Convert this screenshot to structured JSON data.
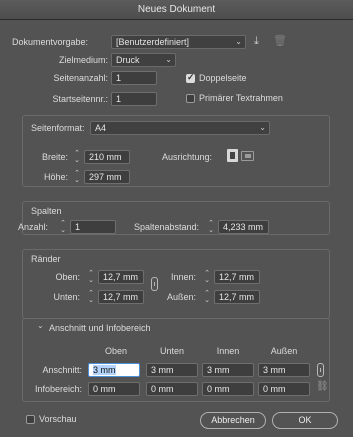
{
  "window": {
    "title": "Neues Dokument"
  },
  "top": {
    "preset_label": "Dokumentvorgabe:",
    "preset_value": "[Benutzerdefiniert]",
    "intent_label": "Zielmedium:",
    "intent_value": "Druck",
    "pages_label": "Seitenanzahl:",
    "pages_value": "1",
    "facing_label": "Doppelseite",
    "facing_checked": true,
    "start_label": "Startseitennr.:",
    "start_value": "1",
    "primary_frame_label": "Primärer Textrahmen",
    "primary_frame_checked": false
  },
  "page_size": {
    "label": "Seitenformat:",
    "value": "A4",
    "width_label": "Breite:",
    "width_value": "210 mm",
    "height_label": "Höhe:",
    "height_value": "297 mm",
    "orientation_label": "Ausrichtung:"
  },
  "columns": {
    "title": "Spalten",
    "number_label": "Anzahl:",
    "number_value": "1",
    "gutter_label": "Spaltenabstand:",
    "gutter_value": "4,233 mm"
  },
  "margins": {
    "title": "Ränder",
    "top_label": "Oben:",
    "top_value": "12,7 mm",
    "bottom_label": "Unten:",
    "bottom_value": "12,7 mm",
    "inside_label": "Innen:",
    "inside_value": "12,7 mm",
    "outside_label": "Außen:",
    "outside_value": "12,7 mm"
  },
  "bleed": {
    "title": "Anschnitt und Infobereich",
    "headers": [
      "Oben",
      "Unten",
      "Innen",
      "Außen"
    ],
    "bleed_label": "Anschnitt:",
    "bleed_values": [
      "3 mm",
      "3 mm",
      "3 mm",
      "3 mm"
    ],
    "slug_label": "Infobereich:",
    "slug_values": [
      "0 mm",
      "0 mm",
      "0 mm",
      "0 mm"
    ]
  },
  "footer": {
    "preview_label": "Vorschau",
    "cancel_label": "Abbrechen",
    "ok_label": "OK"
  },
  "colors": {
    "dialog_bg": "#535353",
    "titlebar": "#4d4d4d",
    "field_bg": "#3e3e3e",
    "highlight": "#b3d4fc"
  }
}
